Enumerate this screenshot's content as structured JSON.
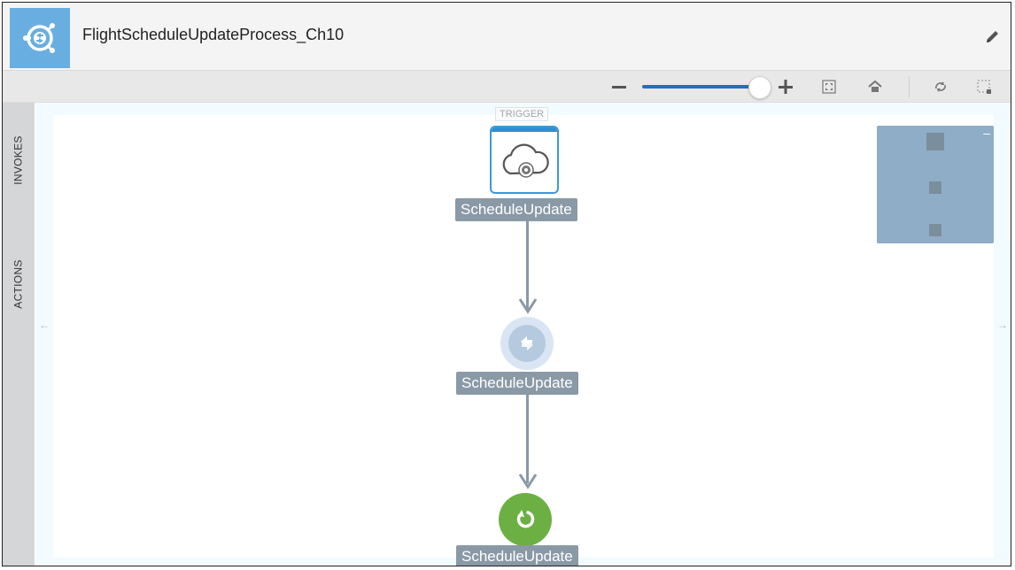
{
  "header": {
    "title": "FlightScheduleUpdateProcess_Ch10",
    "app_icon": "integration-icon",
    "edit_icon": "pencil-icon"
  },
  "toolbar": {
    "zoom_level": 0.92,
    "buttons": [
      "zoom-out-icon",
      "zoom-in-icon",
      "fit-icon",
      "home-icon",
      "refresh-icon",
      "select-icon"
    ]
  },
  "side_panel": {
    "tabs": [
      "INVOKES",
      "ACTIONS"
    ]
  },
  "canvas": {
    "trigger_label": "TRIGGER",
    "nodes": [
      {
        "label": "ScheduleUpdate",
        "icon": "cloud-icon",
        "kind": "trigger"
      },
      {
        "label": "ScheduleUpdate",
        "icon": "map-icon",
        "kind": "map"
      },
      {
        "label": "ScheduleUpdate",
        "icon": "return-icon",
        "kind": "return"
      }
    ],
    "minimap_collapse": "–"
  },
  "colors": {
    "accent": "#1f6fc7",
    "node_label_bg": "#8a99a6",
    "trigger_border": "#3d9ad6",
    "return_node": "#6cb043",
    "minimap": "#8fadc6"
  }
}
